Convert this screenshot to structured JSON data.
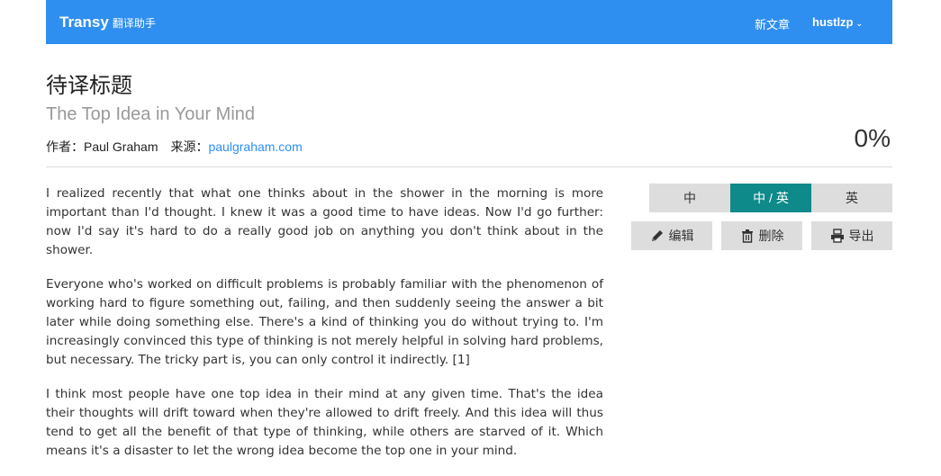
{
  "nav": {
    "brand": "Transy",
    "brand_sub": "翻译助手",
    "new_article": "新文章",
    "user": "hustlzp"
  },
  "article": {
    "title_zh": "待译标题",
    "title_en": "The Top Idea in Your Mind",
    "author_label": "作者：",
    "author": "Paul Graham",
    "source_label": "来源：",
    "source": "paulgraham.com",
    "progress": "0%",
    "paragraphs": [
      "I realized recently that what one thinks about in the shower in the morning is more important than I'd thought. I knew it was a good time to have ideas. Now I'd go further: now I'd say it's hard to do a really good job on anything you don't think about in the shower.",
      "Everyone who's worked on difficult problems is probably familiar with the phenomenon of working hard to figure something out, failing, and then suddenly seeing the answer a bit later while doing something else. There's a kind of thinking you do without trying to. I'm increasingly convinced this type of thinking is not merely helpful in solving hard problems, but necessary. The tricky part is, you can only control it indirectly. [1]",
      "I think most people have one top idea in their mind at any given time. That's the idea their thoughts will drift toward when they're allowed to drift freely. And this idea will thus tend to get all the benefit of that type of thinking, while others are starved of it. Which means it's a disaster to let the wrong idea become the top one in your mind."
    ]
  },
  "view_modes": {
    "zh": "中",
    "zh_en": "中 / 英",
    "en": "英",
    "active": "zh_en"
  },
  "actions": {
    "edit": "编辑",
    "delete": "删除",
    "export": "导出"
  },
  "colors": {
    "navbar": "#2f8ff0",
    "active_mode": "#0e8a8a",
    "link": "#2f8ff0"
  }
}
